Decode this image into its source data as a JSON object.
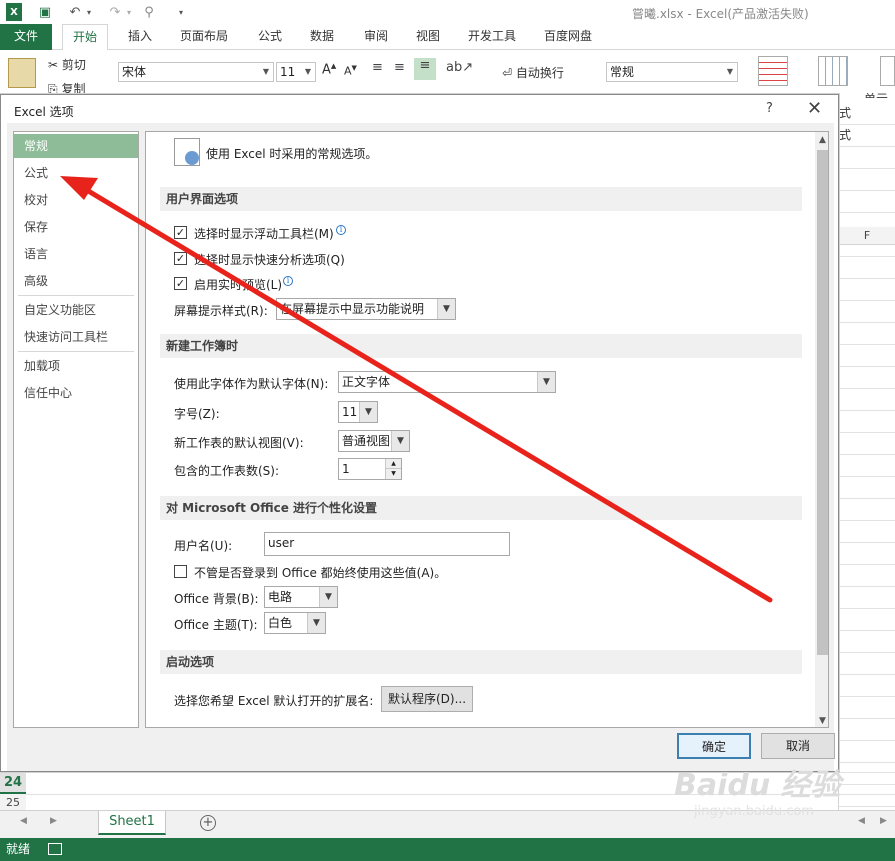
{
  "window": {
    "title": "嘗曦.xlsx - Excel(产品激活失败)"
  },
  "ribbon": {
    "tabs": [
      "文件",
      "开始",
      "插入",
      "页面布局",
      "公式",
      "数据",
      "审阅",
      "视图",
      "开发工具",
      "百度网盘"
    ],
    "cut_label": "剪切",
    "copy_label": "复制",
    "font_name": "宋体",
    "font_size": "11",
    "wrap_text_label": "自动换行",
    "number_format": "常规",
    "cell_styles_label": "单元格",
    "fragment_format": "式",
    "fragment_format2": "式"
  },
  "sheet": {
    "col_label": "F",
    "row_24": "24",
    "row_25": "25",
    "tab_name": "Sheet1",
    "status": "就绪"
  },
  "dialog": {
    "title": "Excel 选项",
    "help": "?",
    "close": "✕",
    "nav": {
      "items": [
        "常规",
        "公式",
        "校对",
        "保存",
        "语言",
        "高级",
        "自定义功能区",
        "快速访问工具栏",
        "加载项",
        "信任中心"
      ],
      "selected": "常规"
    },
    "header_text": "使用 Excel 时采用的常规选项。",
    "ui_section": {
      "title": "用户界面选项",
      "mini_toolbar": "选择时显示浮动工具栏(M)",
      "quick_analysis": "选择时显示快速分析选项(Q)",
      "live_preview": "启用实时预览(L)",
      "screentip_label": "屏幕提示样式(R):",
      "screentip_value": "在屏幕提示中显示功能说明"
    },
    "new_wb_section": {
      "title": "新建工作簿时",
      "font_label": "使用此字体作为默认字体(N):",
      "font_value": "正文字体",
      "size_label": "字号(Z):",
      "size_value": "11",
      "view_label": "新工作表的默认视图(V):",
      "view_value": "普通视图",
      "sheets_label": "包含的工作表数(S):",
      "sheets_value": "1"
    },
    "personalize_section": {
      "title": "对 Microsoft Office 进行个性化设置",
      "username_label": "用户名(U):",
      "username_value": "user",
      "always_use": "不管是否登录到 Office 都始终使用这些值(A)。",
      "background_label": "Office 背景(B):",
      "background_value": "电路",
      "theme_label": "Office 主题(T):",
      "theme_value": "白色"
    },
    "startup_section": {
      "title": "启动选项",
      "ext_label": "选择您希望 Excel 默认打开的扩展名:",
      "default_programs_button": "默认程序(D)..."
    },
    "ok_button": "确定",
    "cancel_button": "取消"
  },
  "annotation": {
    "arrow_color": "#e8231b"
  },
  "watermark": {
    "line1": "Baidu 经验",
    "line2": "jingyan.baidu.com"
  },
  "colors": {
    "excel_green": "#217346",
    "nav_selected": "#8fbc98"
  }
}
